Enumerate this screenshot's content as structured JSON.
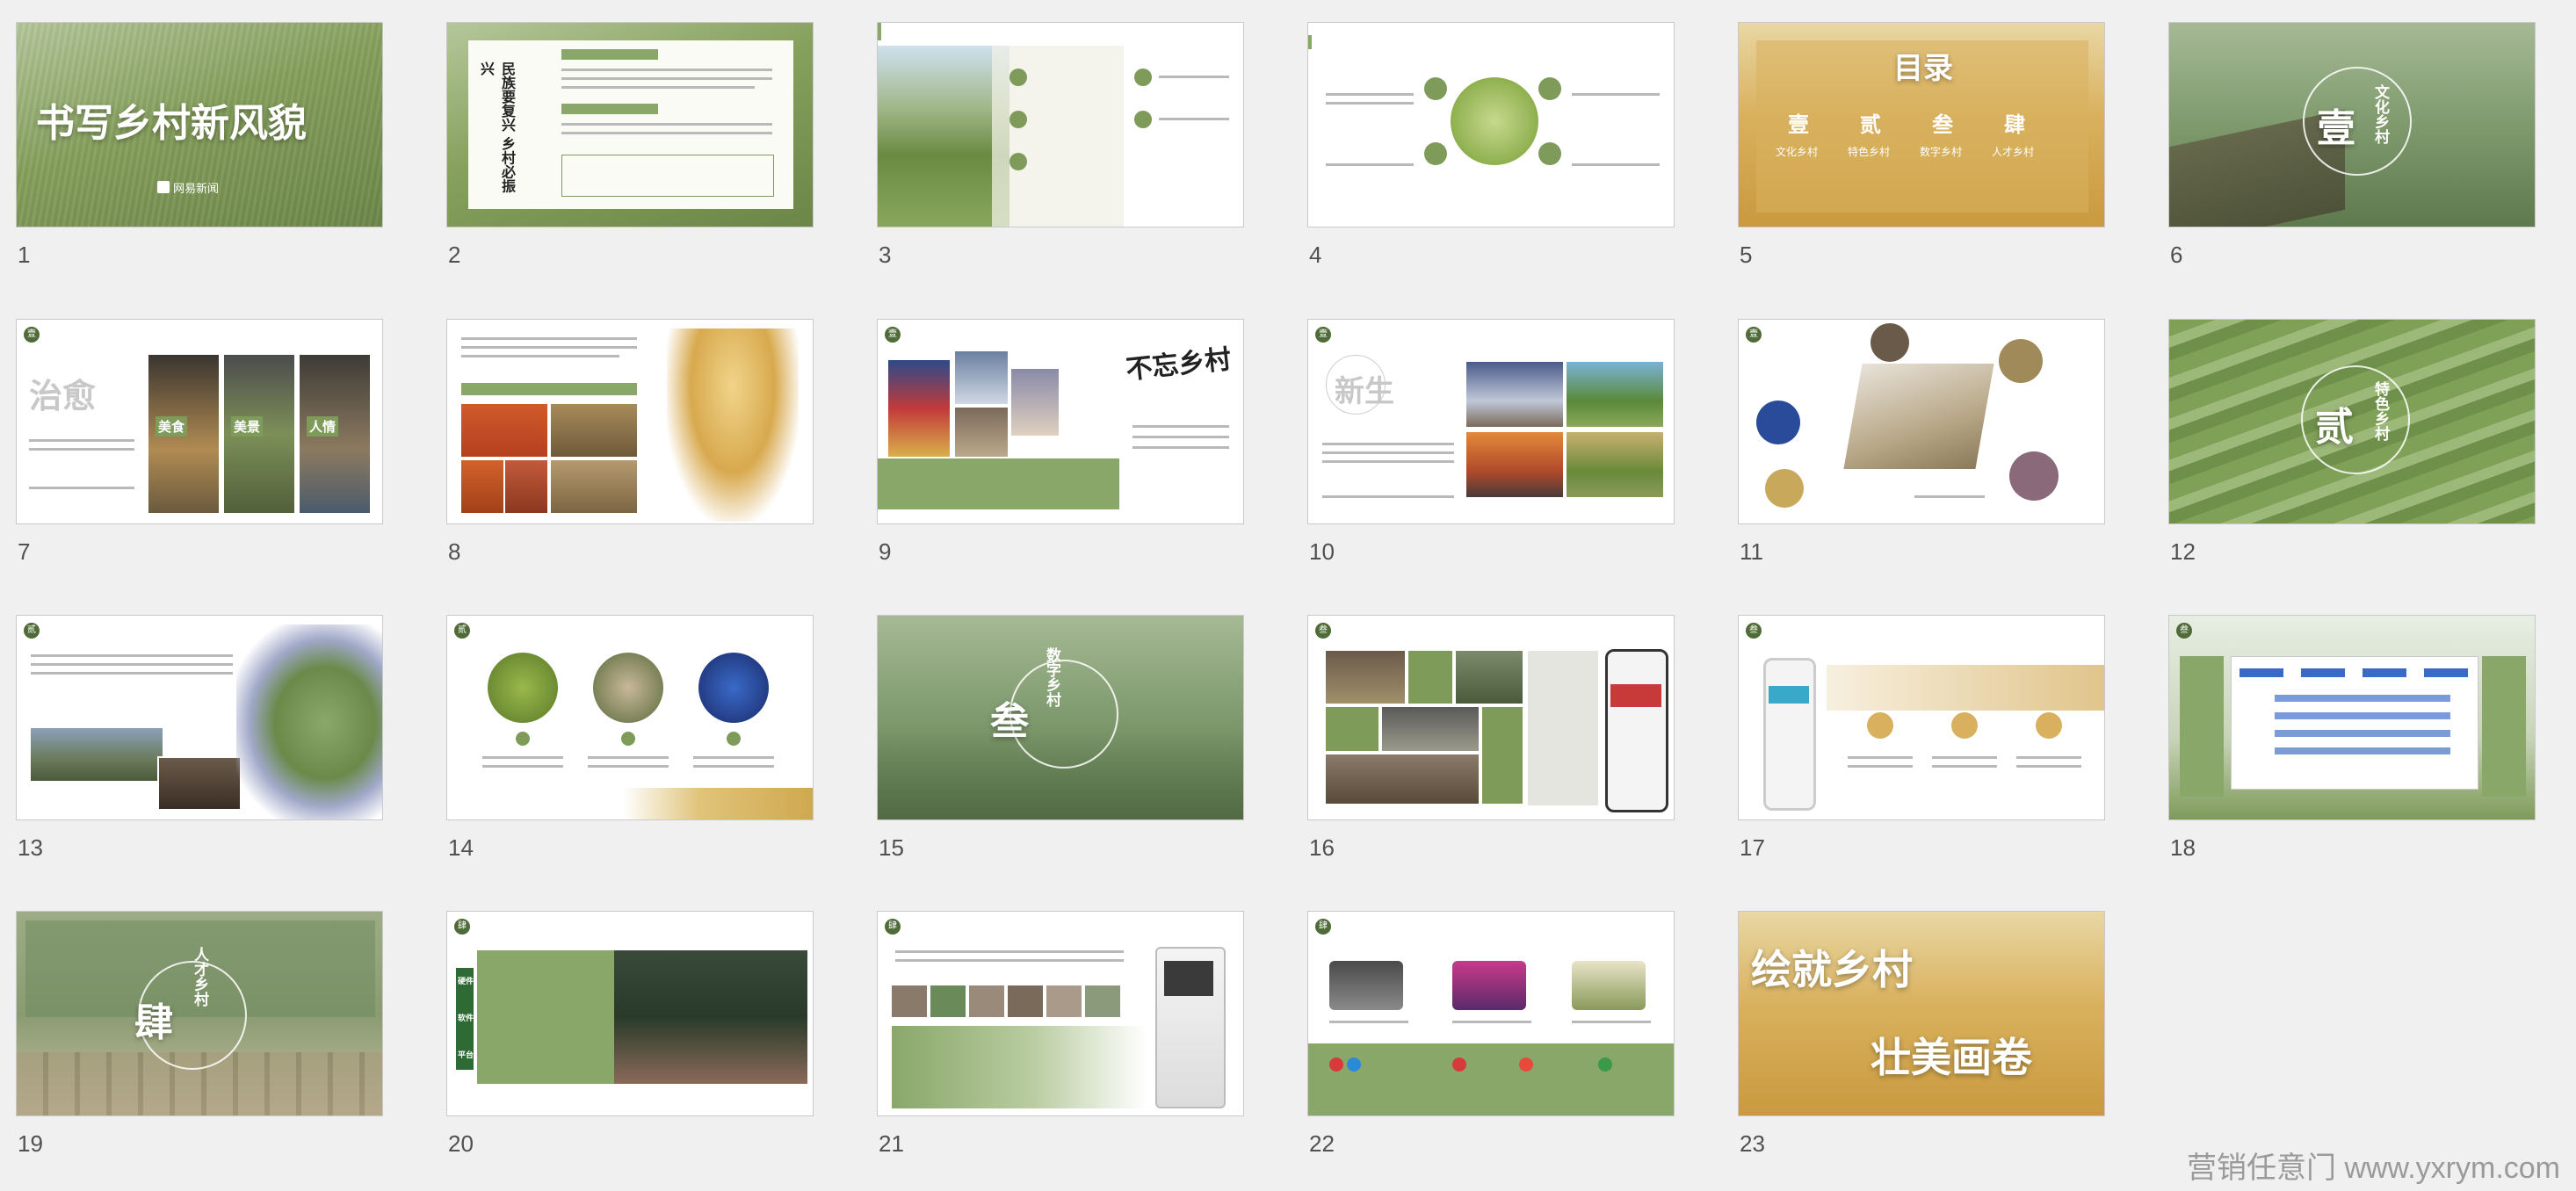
{
  "slides": [
    {
      "number": "1",
      "title": "书写乡村新风貌",
      "brand": "网易新闻"
    },
    {
      "number": "2",
      "title": "民族要复兴 乡村必振兴"
    },
    {
      "number": "3"
    },
    {
      "number": "4"
    },
    {
      "number": "5",
      "title": "目录",
      "chapter_numerals": [
        "壹",
        "贰",
        "叁",
        "肆"
      ],
      "chapter_names": [
        "文化乡村",
        "特色乡村",
        "数字乡村",
        "人才乡村"
      ]
    },
    {
      "number": "6",
      "numeral": "壹",
      "title": "文化乡村"
    },
    {
      "number": "7",
      "big_text": "治愈",
      "labels": [
        "美食",
        "美景",
        "人情"
      ]
    },
    {
      "number": "8"
    },
    {
      "number": "9",
      "calligraphy": "不忘乡村"
    },
    {
      "number": "10",
      "big_text": "新生"
    },
    {
      "number": "11"
    },
    {
      "number": "12",
      "numeral": "贰",
      "title": "特色乡村"
    },
    {
      "number": "13"
    },
    {
      "number": "14"
    },
    {
      "number": "15",
      "numeral": "叁",
      "title": "数字乡村"
    },
    {
      "number": "16"
    },
    {
      "number": "17"
    },
    {
      "number": "18"
    },
    {
      "number": "19",
      "numeral": "肆",
      "title": "人才乡村"
    },
    {
      "number": "20",
      "side_labels": [
        "硬件",
        "软件",
        "平台"
      ]
    },
    {
      "number": "21"
    },
    {
      "number": "22"
    },
    {
      "number": "23",
      "title_line1": "绘就乡村",
      "title_line2": "壮美画卷"
    }
  ],
  "watermark": "营销任意门 www.yxrym.com",
  "colors": {
    "background": "#f0f0f0",
    "accent_green": "#7e9b5a",
    "dark_green": "#4f6b38",
    "wheat": "#d9b15e"
  }
}
